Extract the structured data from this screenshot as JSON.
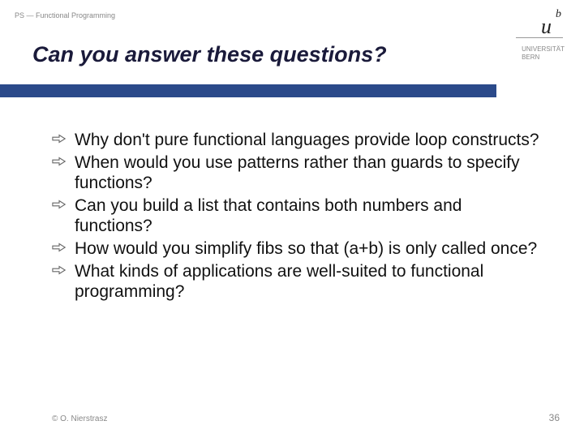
{
  "breadcrumb": "PS — Functional Programming",
  "title": "Can you answer these questions?",
  "logo": {
    "u": "u",
    "b": "b",
    "line1": "UNIVERSITÄT",
    "line2": "BERN"
  },
  "questions": [
    "Why don't pure functional languages provide loop constructs?",
    "When would you use patterns rather than guards to specify functions?",
    "Can you build a list that contains both numbers and functions?",
    "How would you simplify fibs so that (a+b) is only called once?",
    "What kinds of applications are well-suited to functional programming?"
  ],
  "footer": {
    "copyright": "© O. Nierstrasz",
    "page": "36"
  }
}
